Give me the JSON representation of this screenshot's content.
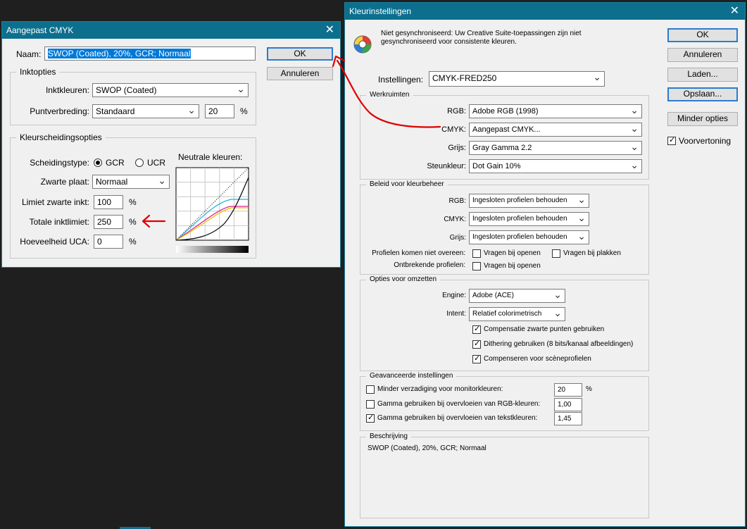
{
  "colors": {
    "titlebar": "#0d6f8e",
    "annotation_red": "#e00000",
    "highlight": "#0078d7"
  },
  "dialog_cmyk": {
    "title": "Aangepast CMYK",
    "name_label": "Naam:",
    "name_value": "SWOP (Coated), 20%, GCR; Normaal",
    "ok": "OK",
    "cancel": "Annuleren",
    "ink_options": {
      "title": "Inktopties",
      "inks_label": "Inktkleuren:",
      "inks_value": "SWOP (Coated)",
      "dot_gain_label": "Puntverbreding:",
      "dot_gain_value": "Standaard",
      "dot_gain_pct": "20",
      "pct": "%"
    },
    "separation": {
      "title": "Kleurscheidingsopties",
      "type_label": "Scheidingstype:",
      "gcr": "GCR",
      "ucr": "UCR",
      "black_gen_label": "Zwarte plaat:",
      "black_gen_value": "Normaal",
      "black_limit_label": "Limiet zwarte inkt:",
      "black_limit_value": "100",
      "total_limit_label": "Totale inktlimiet:",
      "total_limit_value": "250",
      "uca_label": "Hoeveelheid UCA:",
      "uca_value": "0",
      "pct": "%",
      "gray_title": "Neutrale kleuren:"
    }
  },
  "dialog_settings": {
    "title": "Kleurinstellingen",
    "sync_line1": "Niet gesynchroniseerd: Uw Creative Suite-toepassingen zijn niet",
    "sync_line2": "gesynchroniseerd voor consistente kleuren.",
    "settings_label": "Instellingen:",
    "settings_value": "CMYK-FRED250",
    "buttons": {
      "ok": "OK",
      "cancel": "Annuleren",
      "load": "Laden...",
      "save": "Opslaan...",
      "fewer": "Minder opties",
      "preview": "Voorvertoning"
    },
    "workspaces": {
      "title": "Werkruimten",
      "rgb_label": "RGB:",
      "rgb_value": "Adobe RGB (1998)",
      "cmyk_label": "CMYK:",
      "cmyk_value": "Aangepast CMYK...",
      "gray_label": "Grijs:",
      "gray_value": "Gray Gamma 2.2",
      "spot_label": "Steunkleur:",
      "spot_value": "Dot Gain 10%"
    },
    "policies": {
      "title": "Beleid voor kleurbeheer",
      "rgb_label": "RGB:",
      "rgb_value": "Ingesloten profielen behouden",
      "cmyk_label": "CMYK:",
      "cmyk_value": "Ingesloten profielen behouden",
      "gray_label": "Grijs:",
      "gray_value": "Ingesloten profielen behouden",
      "mismatch_label": "Profielen komen niet overeen:",
      "ask_open": "Vragen bij openen",
      "ask_paste": "Vragen bij plakken",
      "missing_label": "Ontbrekende profielen:",
      "missing_ask_open": "Vragen bij openen"
    },
    "conversion": {
      "title": "Opties voor omzetten",
      "engine_label": "Engine:",
      "engine_value": "Adobe (ACE)",
      "intent_label": "Intent:",
      "intent_value": "Relatief colorimetrisch",
      "bpc": "Compensatie zwarte punten gebruiken",
      "dither": "Dithering gebruiken (8 bits/kanaal afbeeldingen)",
      "scene": "Compenseren voor scèneprofielen"
    },
    "advanced": {
      "title": "Geavanceerde instellingen",
      "desaturate": "Minder verzadiging voor monitorkleuren:",
      "desaturate_value": "20",
      "pct": "%",
      "blend_rgb": "Gamma gebruiken bij overvloeien van RGB-kleuren:",
      "blend_rgb_value": "1,00",
      "blend_text": "Gamma gebruiken bij overvloeien van tekstkleuren:",
      "blend_text_value": "1,45"
    },
    "description": {
      "title": "Beschrijving",
      "text": "SWOP (Coated), 20%, GCR; Normaal"
    }
  }
}
